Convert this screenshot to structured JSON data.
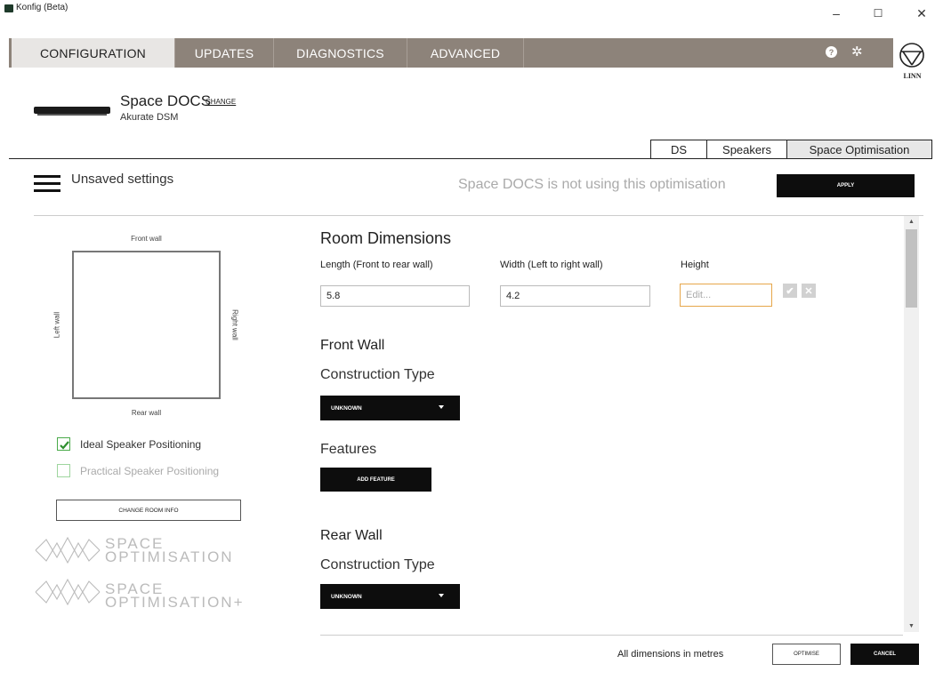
{
  "window": {
    "title": "Konfig (Beta)",
    "minimize": "–",
    "maximize": "☐",
    "close": "✕"
  },
  "nav": {
    "tabs": [
      "CONFIGURATION",
      "UPDATES",
      "DIAGNOSTICS",
      "ADVANCED"
    ],
    "help_glyph": "?",
    "settings_glyph": "✲",
    "logo_text": "LINN"
  },
  "device": {
    "name": "Space DOCS",
    "change_label": "CHANGE",
    "model": "Akurate DSM"
  },
  "subtabs": [
    "DS",
    "Speakers",
    "Space Optimisation"
  ],
  "header": {
    "status": "Unsaved settings",
    "notice": "Space DOCS is not using this optimisation",
    "apply_label": "APPLY"
  },
  "room": {
    "front": "Front wall",
    "rear": "Rear wall",
    "left": "Left wall",
    "right": "Right wall",
    "ideal_label": "Ideal Speaker Positioning",
    "ideal_checked": true,
    "practical_label": "Practical Speaker Positioning",
    "practical_checked": false,
    "change_info_label": "CHANGE ROOM INFO",
    "logo1": [
      "SPACE",
      "OPTIMISATION"
    ],
    "logo2": [
      "SPACE",
      "OPTIMISATION+"
    ]
  },
  "form": {
    "room_dimensions_title": "Room Dimensions",
    "length_label": "Length (Front to rear wall)",
    "length_value": "5.8",
    "width_label": "Width (Left to right wall)",
    "width_value": "4.2",
    "height_label": "Height",
    "height_placeholder": "Edit...",
    "confirm_glyph": "✔",
    "discard_glyph": "✕",
    "front_wall_title": "Front Wall",
    "front_construction_label": "Construction Type",
    "front_construction_value": "UNKNOWN",
    "features_label": "Features",
    "add_feature_label": "ADD FEATURE",
    "rear_wall_title": "Rear Wall",
    "rear_construction_label": "Construction Type",
    "rear_construction_value": "UNKNOWN"
  },
  "scroll": {
    "up": "▲",
    "down": "▼"
  },
  "footer": {
    "note": "All dimensions in metres",
    "optimise_label": "OPTIMISE",
    "cancel_label": "CANCEL"
  },
  "colors": {
    "nav_bg": "#8d837a",
    "accent_green": "#3a9a3a",
    "focus_orange": "#e6a64a"
  }
}
